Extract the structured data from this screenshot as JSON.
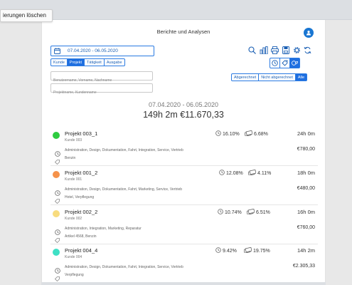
{
  "tooltip": "ierungen löschen",
  "header": {
    "title": "Berichte und Analysen"
  },
  "date_range_field": "07.04.2020 - 06.05.2020",
  "group_tabs": [
    {
      "label": "Kunde",
      "active": false
    },
    {
      "label": "Projekt",
      "active": true
    },
    {
      "label": "Tätigkeit",
      "active": false
    },
    {
      "label": "Ausgabe",
      "active": false
    }
  ],
  "inputs": {
    "employee_placeholder": "Benutzername, Vorname, Nachname",
    "project_placeholder": "Projektname, Kundenname"
  },
  "toolbar_icons": [
    "search-icon",
    "bar-chart-icon",
    "print-icon",
    "export-icon",
    "settings-icon",
    "refresh-icon"
  ],
  "view_buttons": [
    "clock-icon",
    "tag-icon",
    "clock-tag-icon"
  ],
  "billing_filter": [
    {
      "label": "Abgerechnet",
      "active": false
    },
    {
      "label": "Nicht abgerechnet",
      "active": false
    },
    {
      "label": "Alle",
      "active": true
    }
  ],
  "summary": {
    "range": "07.04.2020 - 06.05.2020",
    "totals": "149h 2m  €11.670,33"
  },
  "projects": [
    {
      "name": "Projekt 003_1",
      "client": "Kunde 003",
      "color": "#2ecc40",
      "time_pct": "16.10%",
      "money_pct": "6.68%",
      "hours": "24h 0m",
      "tasks": "Administration, Design, Dokumentation, Fahrt, Integration, Service, Vertrieb",
      "expenses": "Benzin",
      "amount": "€780,00"
    },
    {
      "name": "Projekt 001_2",
      "client": "Kunde 001",
      "color": "#f5924a",
      "time_pct": "12.08%",
      "money_pct": "4.11%",
      "hours": "18h 0m",
      "tasks": "Administration, Design, Dokumentation, Fahrt, Marketing, Service, Vertrieb",
      "expenses": "Hotel, Verpflegung",
      "amount": "€480,00"
    },
    {
      "name": "Projekt 002_2",
      "client": "Kunde 002",
      "color": "#f8dc7e",
      "time_pct": "10.74%",
      "money_pct": "6.51%",
      "hours": "16h 0m",
      "tasks": "Administration, Integration, Marketing, Reparatur",
      "expenses": "Artikel 4568, Benzin",
      "amount": "€760,00"
    },
    {
      "name": "Projekt 004_4",
      "client": "Kunde 004",
      "color": "#3fe0c5",
      "time_pct": "9.42%",
      "money_pct": "19.75%",
      "hours": "14h 2m",
      "tasks": "Administration, Design, Dokumentation, Fahrt, Integration, Service, Vertrieb",
      "expenses": "Verpflegung",
      "amount": "€2.305,33"
    }
  ]
}
